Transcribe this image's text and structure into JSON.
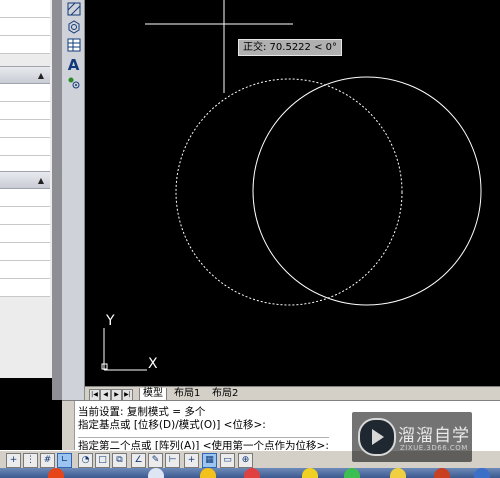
{
  "tooltip": "正交: 70.5222 < 0°",
  "layout_tabs": {
    "model": "模型",
    "layout1": "布局1",
    "layout2": "布局2"
  },
  "command_lines": [
    "当前设置:  复制模式 = 多个",
    "指定基点或 [位移(D)/模式(O)] <位移>:",
    "指定第二个点或 [阵列(A)] <使用第一个点作为位移>:"
  ],
  "ucs": {
    "x_label": "X",
    "y_label": "Y"
  },
  "watermark": {
    "title": "溜溜自学",
    "url": "ZIXUE.3D66.COM"
  },
  "toolbar_icons": [
    "hatch-icon",
    "region-icon",
    "table-icon",
    "text-icon",
    "point-icon"
  ],
  "status_icons": [
    "snap-icon",
    "grid-icon",
    "ortho-icon",
    "polar-icon",
    "osnap-icon",
    "otrack-icon",
    "ducs-icon",
    "dyn-icon",
    "lweight-icon",
    "qp-icon",
    "sc-icon"
  ],
  "colors": {
    "canvas": "#000000",
    "geometry": "#ffffff",
    "tooltip_bg": "#b0b0b0"
  }
}
